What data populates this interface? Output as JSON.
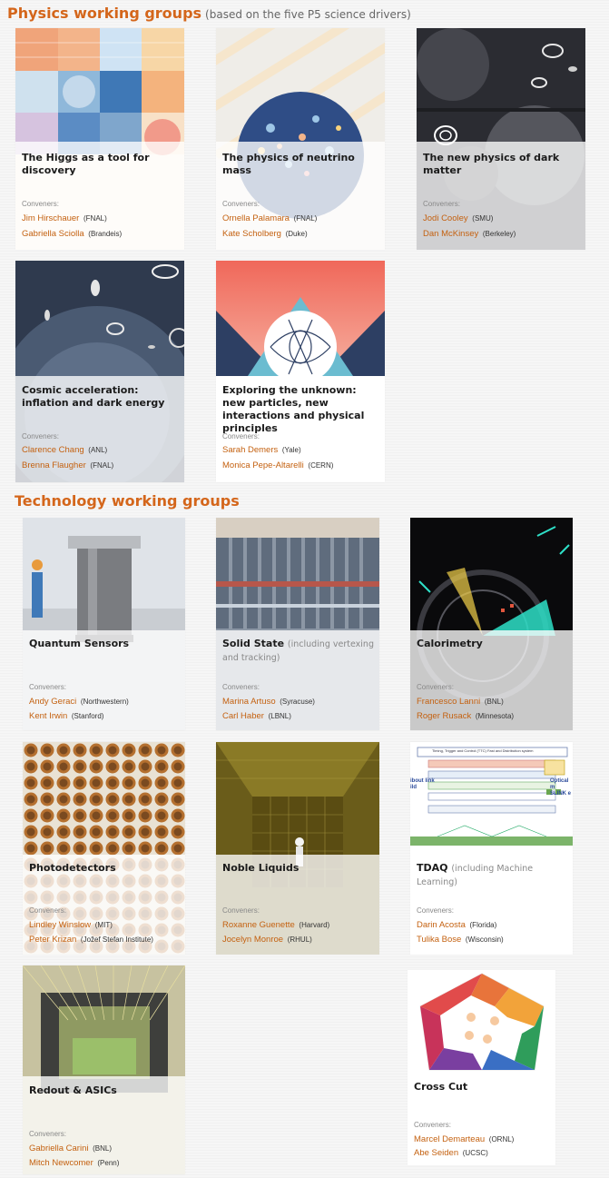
{
  "physics_section": {
    "title": "Physics working groups",
    "subtitle": "(based on the five P5 science drivers)"
  },
  "physics_groups": [
    {
      "title": "The Higgs as a tool for discovery",
      "conveners_label": "Conveners:",
      "conveners": [
        {
          "name": "Jim Hirschauer",
          "affiliation": "(FNAL)"
        },
        {
          "name": "Gabriella Sciolla",
          "affiliation": "(Brandeis)"
        }
      ]
    },
    {
      "title": "The physics of neutrino mass",
      "conveners_label": "Conveners:",
      "conveners": [
        {
          "name": "Ornella Palamara",
          "affiliation": "(FNAL)"
        },
        {
          "name": "Kate Scholberg",
          "affiliation": "(Duke)"
        }
      ]
    },
    {
      "title": "The new physics of dark matter",
      "conveners_label": "Conveners:",
      "conveners": [
        {
          "name": "Jodi Cooley",
          "affiliation": "(SMU)"
        },
        {
          "name": "Dan McKinsey",
          "affiliation": "(Berkeley)"
        }
      ]
    },
    {
      "title": "Cosmic acceleration: inflation and dark energy",
      "conveners_label": "Conveners:",
      "conveners": [
        {
          "name": "Clarence Chang",
          "affiliation": "(ANL)"
        },
        {
          "name": "Brenna Flaugher",
          "affiliation": "(FNAL)"
        }
      ]
    },
    {
      "title": "Exploring the unknown: new particles, new interactions and physical principles",
      "conveners_label": "Conveners:",
      "conveners": [
        {
          "name": "Sarah Demers",
          "affiliation": "(Yale)"
        },
        {
          "name": "Monica Pepe-Altarelli",
          "affiliation": "(CERN)"
        }
      ]
    }
  ],
  "technology_section": {
    "title": "Technology working groups"
  },
  "technology_groups": [
    {
      "title": "Quantum Sensors",
      "note": "",
      "conveners_label": "Conveners:",
      "conveners": [
        {
          "name": "Andy Geraci",
          "affiliation": "(Northwestern)"
        },
        {
          "name": "Kent Irwin",
          "affiliation": "(Stanford)"
        }
      ]
    },
    {
      "title": "Solid State",
      "note": "(including vertexing and tracking)",
      "conveners_label": "Conveners:",
      "conveners": [
        {
          "name": "Marina Artuso",
          "affiliation": "(Syracuse)"
        },
        {
          "name": "Carl Haber",
          "affiliation": "(LBNL)"
        }
      ]
    },
    {
      "title": "Calorimetry",
      "note": "",
      "conveners_label": "Conveners:",
      "conveners": [
        {
          "name": "Francesco Lanni",
          "affiliation": "(BNL)"
        },
        {
          "name": "Roger Rusack",
          "affiliation": "(Minnesota)"
        }
      ]
    },
    {
      "title": "Photodetectors",
      "note": "",
      "conveners_label": "Conveners:",
      "conveners": [
        {
          "name": "Lindley Winslow",
          "affiliation": "(MIT)"
        },
        {
          "name": "Peter Krizan",
          "affiliation": "(Jožef Stefan Institute)"
        }
      ]
    },
    {
      "title": "Noble Liquids",
      "note": "",
      "conveners_label": "Conveners:",
      "conveners": [
        {
          "name": "Roxanne Guenette",
          "affiliation": "(Harvard)"
        },
        {
          "name": "Jocelyn Monroe",
          "affiliation": "(RHUL)"
        }
      ]
    },
    {
      "title": "TDAQ",
      "note": "(including Machine Learning)",
      "conveners_label": "Conveners:",
      "conveners": [
        {
          "name": "Darin Acosta",
          "affiliation": "(Florida)"
        },
        {
          "name": "Tulika Bose",
          "affiliation": "(Wisconsin)"
        }
      ]
    },
    {
      "title": "Redout & ASICs",
      "note": "",
      "conveners_label": "Conveners:",
      "conveners": [
        {
          "name": "Gabriella Carini",
          "affiliation": "(BNL)"
        },
        {
          "name": "Mitch Newcomer",
          "affiliation": "(Penn)"
        }
      ]
    },
    {
      "title": "Cross Cut",
      "note": "",
      "conveners_label": "Conveners:",
      "conveners": [
        {
          "name": "Marcel Demarteau",
          "affiliation": "(ORNL)"
        },
        {
          "name": "Abe Seiden",
          "affiliation": "(UCSC)"
        }
      ]
    }
  ],
  "tdaq_diagram_text": {
    "header": "Timing, Trigger and Control (TTC) Fast and Distribution system",
    "left_label": "ibout link\nild",
    "right_label": "Optical m\nSLINK e"
  }
}
